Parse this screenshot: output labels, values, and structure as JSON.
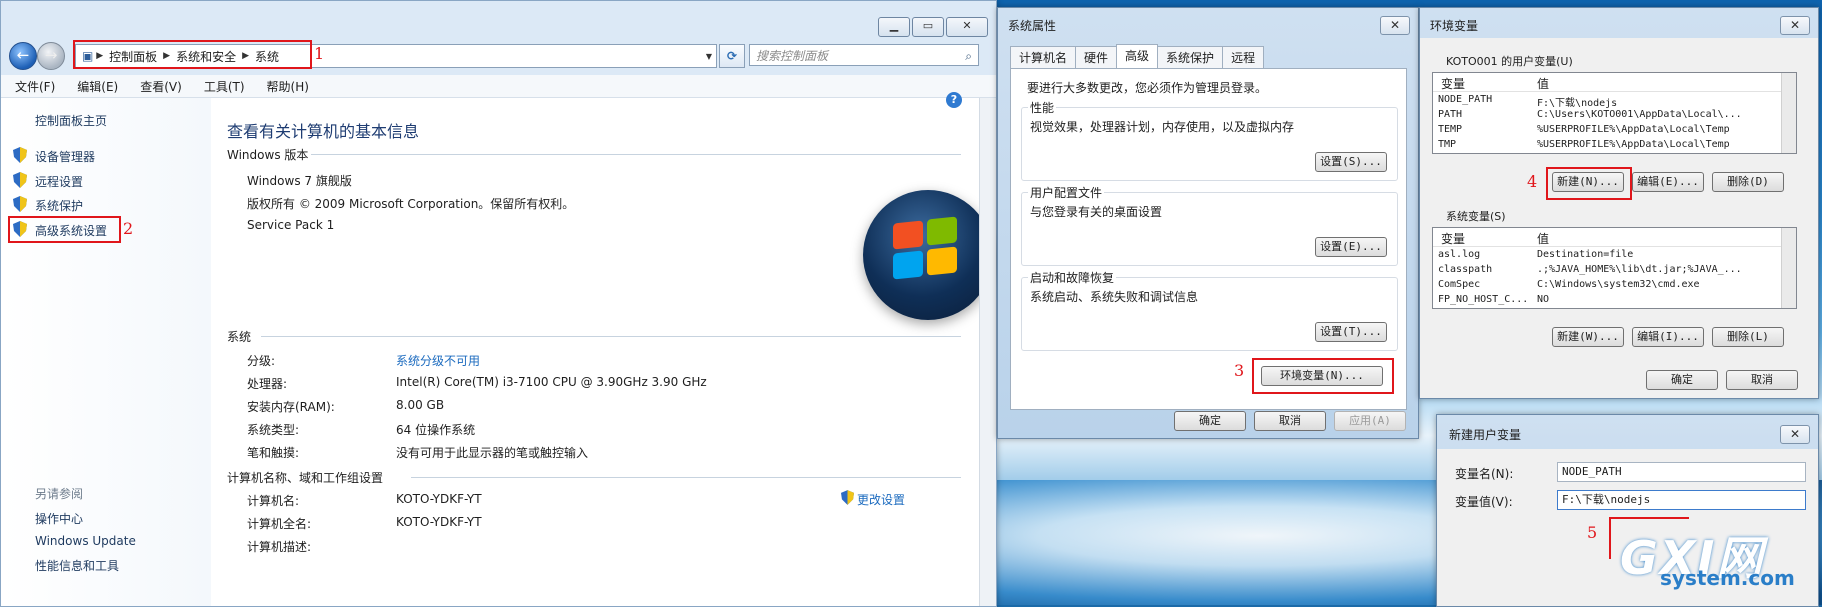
{
  "control_panel": {
    "breadcrumb": [
      "控制面板",
      "系统和安全",
      "系统"
    ],
    "search_placeholder": "搜索控制面板",
    "menu": [
      "文件(F)",
      "编辑(E)",
      "查看(V)",
      "工具(T)",
      "帮助(H)"
    ],
    "side_home": "控制面板主页",
    "side_links": [
      "设备管理器",
      "远程设置",
      "系统保护",
      "高级系统设置"
    ],
    "see_also_title": "另请参阅",
    "see_also": [
      "操作中心",
      "Windows Update",
      "性能信息和工具"
    ],
    "page_title": "查看有关计算机的基本信息",
    "edition_section": "Windows 版本",
    "edition_lines": [
      "Windows 7 旗舰版",
      "版权所有 © 2009 Microsoft Corporation。保留所有权利。",
      "Service Pack 1"
    ],
    "system_section": "系统",
    "system_rows": [
      {
        "label": "分级:",
        "value": "系统分级不可用"
      },
      {
        "label": "处理器:",
        "value": "Intel(R) Core(TM) i3-7100 CPU @ 3.90GHz   3.90 GHz"
      },
      {
        "label": "安装内存(RAM):",
        "value": "8.00 GB"
      },
      {
        "label": "系统类型:",
        "value": "64 位操作系统"
      },
      {
        "label": "笔和触摸:",
        "value": "没有可用于此显示器的笔或触控输入"
      }
    ],
    "computer_section": "计算机名称、域和工作组设置",
    "computer_rows": [
      {
        "label": "计算机名:",
        "value": "KOTO-YDKF-YT"
      },
      {
        "label": "计算机全名:",
        "value": "KOTO-YDKF-YT"
      },
      {
        "label": "计算机描述:",
        "value": ""
      }
    ],
    "change_settings": "更改设置"
  },
  "annotations": [
    "1",
    "2",
    "3",
    "4",
    "5"
  ],
  "system_properties": {
    "title": "系统属性",
    "tabs": [
      "计算机名",
      "硬件",
      "高级",
      "系统保护",
      "远程"
    ],
    "admin_note": "要进行大多数更改，您必须作为管理员登录。",
    "groups": [
      {
        "title": "性能",
        "desc": "视觉效果，处理器计划，内存使用，以及虚拟内存",
        "button": "设置(S)..."
      },
      {
        "title": "用户配置文件",
        "desc": "与您登录有关的桌面设置",
        "button": "设置(E)..."
      },
      {
        "title": "启动和故障恢复",
        "desc": "系统启动、系统失败和调试信息",
        "button": "设置(T)..."
      }
    ],
    "env_button": "环境变量(N)...",
    "ok": "确定",
    "cancel": "取消",
    "apply": "应用(A)"
  },
  "env_vars": {
    "title": "环境变量",
    "user_section": "KOTO001 的用户变量(U)",
    "col_var": "变量",
    "col_val": "值",
    "user_vars": [
      {
        "name": "NODE_PATH",
        "value": "F:\\下载\\nodejs"
      },
      {
        "name": "PATH",
        "value": "C:\\Users\\KOTO001\\AppData\\Local\\..."
      },
      {
        "name": "TEMP",
        "value": "%USERPROFILE%\\AppData\\Local\\Temp"
      },
      {
        "name": "TMP",
        "value": "%USERPROFILE%\\AppData\\Local\\Temp"
      }
    ],
    "user_buttons": [
      "新建(N)...",
      "编辑(E)...",
      "删除(D)"
    ],
    "sys_section": "系统变量(S)",
    "sys_vars": [
      {
        "name": "asl.log",
        "value": "Destination=file"
      },
      {
        "name": "classpath",
        "value": ".;%JAVA_HOME%\\lib\\dt.jar;%JAVA_..."
      },
      {
        "name": "ComSpec",
        "value": "C:\\Windows\\system32\\cmd.exe"
      },
      {
        "name": "FP_NO_HOST_C...",
        "value": "NO"
      }
    ],
    "sys_buttons": [
      "新建(W)...",
      "编辑(I)...",
      "删除(L)"
    ],
    "ok": "确定",
    "cancel": "取消"
  },
  "new_var": {
    "title": "新建用户变量",
    "name_label": "变量名(N):",
    "name_value": "NODE_PATH",
    "value_label": "变量值(V):",
    "value_value": "F:\\下载\\nodejs"
  },
  "watermark": {
    "big": "GXI网",
    "small": "system.com"
  },
  "colors": {
    "accent_red": "#e0161b",
    "link_blue": "#1c6bbf",
    "title_blue": "#1e3c72"
  }
}
